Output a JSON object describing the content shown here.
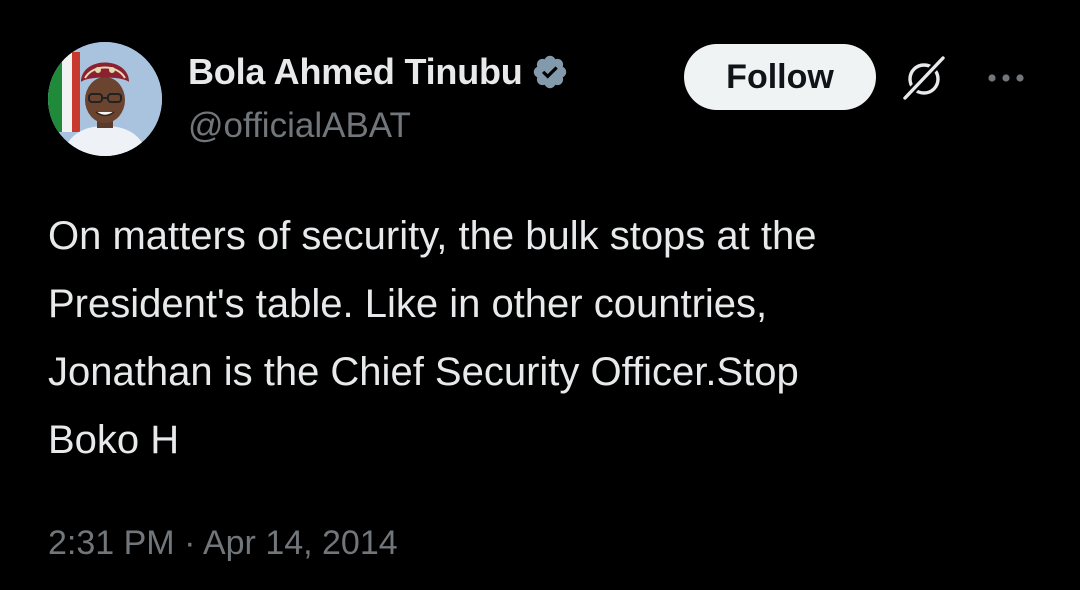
{
  "author": {
    "display_name": "Bola Ahmed Tinubu",
    "handle": "@officialABAT",
    "verified": true,
    "avatar": "profile-photo"
  },
  "actions": {
    "follow_label": "Follow",
    "grok_icon": "grok-icon",
    "more_icon": "more-dots-icon"
  },
  "tweet": {
    "text": "On matters of security, the bulk stops at the\nPresident's table. Like in other countries,\nJonathan is the Chief Security Officer.Stop\nBoko H",
    "timestamp": "2:31 PM · Apr 14, 2014"
  },
  "colors": {
    "background": "#000000",
    "primary_text": "#e7e9ea",
    "secondary_text": "#71767b",
    "verified_badge": "#829aab",
    "follow_button_bg": "#eff3f4"
  }
}
